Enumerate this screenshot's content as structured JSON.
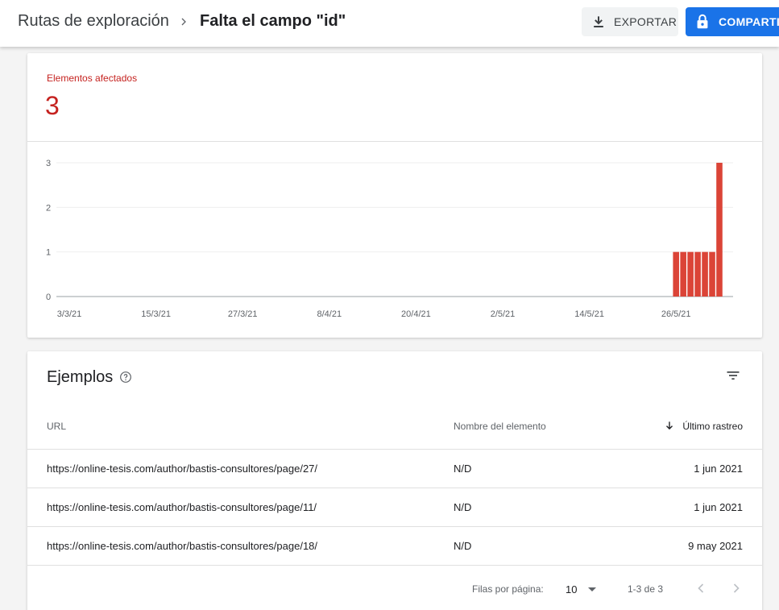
{
  "header": {
    "breadcrumb_parent": "Rutas de exploración",
    "breadcrumb_current": "Falta el campo \"id\"",
    "export_label": "EXPORTAR",
    "share_label": "COMPARTIR"
  },
  "summary": {
    "label": "Elementos afectados",
    "count": "3"
  },
  "chart_data": {
    "type": "bar",
    "ylim": [
      0,
      3
    ],
    "yticks": [
      "0",
      "1",
      "2",
      "3"
    ],
    "xticks": [
      "3/3/21",
      "15/3/21",
      "27/3/21",
      "8/4/21",
      "20/4/21",
      "2/5/21",
      "14/5/21",
      "26/5/21"
    ],
    "x_start": "2021-03-03",
    "x_end": "2021-06-01",
    "x": [
      "2021-05-26",
      "2021-05-27",
      "2021-05-28",
      "2021-05-29",
      "2021-05-30",
      "2021-05-31",
      "2021-06-01"
    ],
    "values": [
      1,
      1,
      1,
      1,
      1,
      1,
      3
    ],
    "bar_color": "#db4437",
    "grid": true
  },
  "examples": {
    "title": "Ejemplos",
    "columns": {
      "url": "URL",
      "name": "Nombre del elemento",
      "last_crawl": "Último rastreo"
    },
    "rows": [
      {
        "url": "https://online-tesis.com/author/bastis-consultores/page/27/",
        "name": "N/D",
        "date": "1 jun 2021"
      },
      {
        "url": "https://online-tesis.com/author/bastis-consultores/page/11/",
        "name": "N/D",
        "date": "1 jun 2021"
      },
      {
        "url": "https://online-tesis.com/author/bastis-consultores/page/18/",
        "name": "N/D",
        "date": "9 may 2021"
      }
    ],
    "pagination": {
      "rows_per_page_label": "Filas por página:",
      "rows_per_page": "10",
      "range": "1-3 de 3"
    }
  },
  "colors": {
    "accent_blue": "#1a73e8",
    "error_red": "#c5221f"
  }
}
